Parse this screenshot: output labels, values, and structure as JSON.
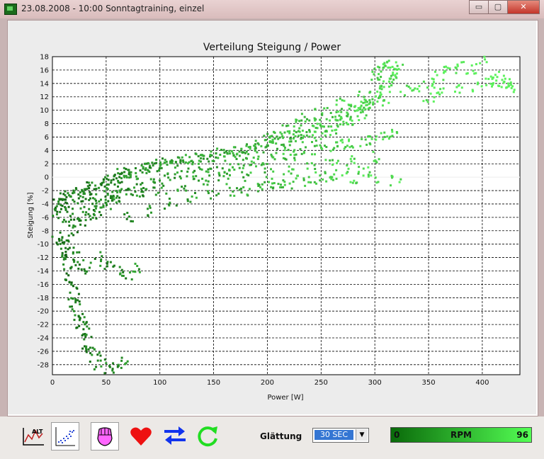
{
  "window": {
    "title": "23.08.2008 - 10:00  Sonntagtraining, einzel"
  },
  "toolbar": {
    "glattung_label": "Glättung",
    "glattung_value": "30 SEC",
    "rpm_label": "RPM",
    "rpm_min": "0",
    "rpm_max": "96"
  },
  "icons": [
    "altitude-chart-icon",
    "scatter-plot-icon",
    "fist-power-icon",
    "heart-icon",
    "swap-arrows-icon",
    "refresh-icon"
  ],
  "colors": {
    "series_dark": "#0b5a0b",
    "series_light": "#5df25d",
    "rpm_start": "#0a6a0a",
    "rpm_end": "#54ff54"
  },
  "chart_data": {
    "type": "scatter",
    "title": "Verteilung Steigung / Power",
    "xlabel": "Power [W]",
    "ylabel": "Steigung [%]",
    "xlim": [
      0,
      435
    ],
    "ylim": [
      -29.5,
      18
    ],
    "xticks": [
      0,
      50,
      100,
      150,
      200,
      250,
      300,
      350,
      400
    ],
    "yticks": [
      18,
      16,
      14,
      12,
      10,
      8,
      6,
      4,
      2,
      0,
      -2,
      -4,
      -6,
      -8,
      -10,
      -12,
      -14,
      -16,
      -18,
      -20,
      -22,
      -24,
      -26,
      -28
    ],
    "grid": true,
    "color_encoding": "cadence",
    "points_x": [
      0,
      2,
      5,
      8,
      10,
      12,
      15,
      18,
      20,
      24,
      28,
      30,
      32,
      35,
      40,
      45,
      48,
      50,
      55,
      60,
      62,
      65,
      70,
      72,
      75,
      80,
      85,
      90,
      95,
      100,
      105,
      110,
      115,
      120,
      125,
      130,
      135,
      140,
      145,
      150,
      155,
      160,
      165,
      170,
      175,
      180,
      185,
      190,
      195,
      200,
      205,
      210,
      215,
      220,
      225,
      230,
      235,
      240,
      245,
      250,
      255,
      260,
      265,
      270,
      275,
      280,
      285,
      290,
      295,
      300,
      305,
      310,
      315,
      320,
      330,
      340,
      350,
      360,
      370,
      380,
      390,
      400,
      410,
      420,
      430,
      15,
      18,
      20,
      25,
      30,
      35,
      40,
      45,
      50,
      55,
      60,
      65,
      70,
      80,
      90,
      100,
      110,
      120,
      130,
      140,
      150,
      160,
      170,
      180,
      190,
      200,
      210,
      220,
      230,
      240,
      250,
      260,
      270,
      280,
      290,
      300,
      310,
      320,
      40,
      60,
      80,
      100,
      120,
      140,
      160,
      180,
      200,
      220,
      240,
      260,
      280,
      300,
      70,
      90,
      110,
      130,
      150,
      170,
      190,
      210,
      230,
      250,
      270,
      290,
      180,
      200,
      220,
      240,
      260,
      280,
      300,
      320,
      230,
      250,
      270,
      290,
      310,
      300,
      305,
      310,
      315,
      320,
      10,
      12,
      14,
      16,
      18,
      20,
      22,
      24,
      26,
      28,
      30,
      32,
      34,
      36,
      40,
      45,
      50,
      55,
      60,
      65,
      5,
      10,
      15,
      20,
      25,
      30,
      40,
      50,
      60,
      70,
      80,
      350,
      360,
      380,
      395,
      405,
      415,
      425,
      200,
      210,
      220,
      230,
      240,
      250,
      260,
      270,
      280,
      290,
      300,
      310
    ],
    "points_y": [
      -5,
      -5.5,
      -4,
      -3,
      -4.5,
      -3.5,
      -2.5,
      -4,
      -3,
      -2,
      -2.5,
      -1.5,
      -3,
      -2,
      -1.5,
      -1,
      -2,
      -1,
      -0.5,
      -1,
      0,
      0.5,
      0,
      1,
      0.5,
      1,
      1.5,
      1,
      2,
      1.5,
      2,
      1.8,
      2.2,
      2.5,
      2,
      2.8,
      3,
      2.5,
      3.2,
      3,
      3.5,
      3.2,
      3.8,
      4,
      3.5,
      4.2,
      4,
      4.5,
      5,
      4.5,
      5,
      5.5,
      4.8,
      5.2,
      6,
      5.5,
      6.5,
      6,
      7,
      6.5,
      7.5,
      7,
      8,
      8.5,
      9,
      8,
      9.5,
      10,
      11,
      12,
      13,
      14,
      15,
      16,
      13,
      13.5,
      14,
      15,
      16,
      17,
      16,
      17.5,
      15,
      14,
      13.5,
      -7,
      -8,
      -6,
      -7,
      -5,
      -6,
      -5.5,
      -4,
      -4.5,
      -3.5,
      -3,
      -2.5,
      -2,
      -1.5,
      -1,
      -0.5,
      0,
      0.2,
      0.5,
      0.8,
      1,
      1.3,
      1.6,
      2,
      2.3,
      2.6,
      3,
      3.3,
      3.6,
      3.9,
      4.2,
      4.5,
      4.8,
      5.1,
      5.4,
      5.7,
      6,
      6.3,
      -4,
      -3,
      -2.5,
      -2,
      -1.5,
      -1,
      -0.5,
      0,
      0.5,
      1,
      1.5,
      2,
      2.5,
      3,
      -6,
      -5,
      -4,
      -3,
      -2.5,
      -2,
      -1.5,
      -1,
      -0.5,
      0,
      0.5,
      1,
      -2,
      -1.5,
      -1,
      -0.5,
      -0.3,
      -0.2,
      -0.4,
      -0.6,
      9,
      10,
      11,
      12,
      13,
      15,
      16,
      17,
      16.5,
      15.5,
      -10,
      -12,
      -13,
      -15,
      -16,
      -18,
      -19,
      -20,
      -21,
      -22,
      -23,
      -24,
      -25,
      -26,
      -27,
      -28,
      -29,
      -29.5,
      -28.5,
      -27.5,
      -9,
      -10,
      -11,
      -12,
      -13,
      -14,
      -12,
      -13,
      -14,
      -14.5,
      -13.5,
      12,
      12.5,
      13,
      13.5,
      14,
      14.5,
      14,
      6,
      6.5,
      7,
      7.5,
      8,
      8.5,
      9,
      9.5,
      10,
      10.5,
      11,
      11.5
    ]
  }
}
